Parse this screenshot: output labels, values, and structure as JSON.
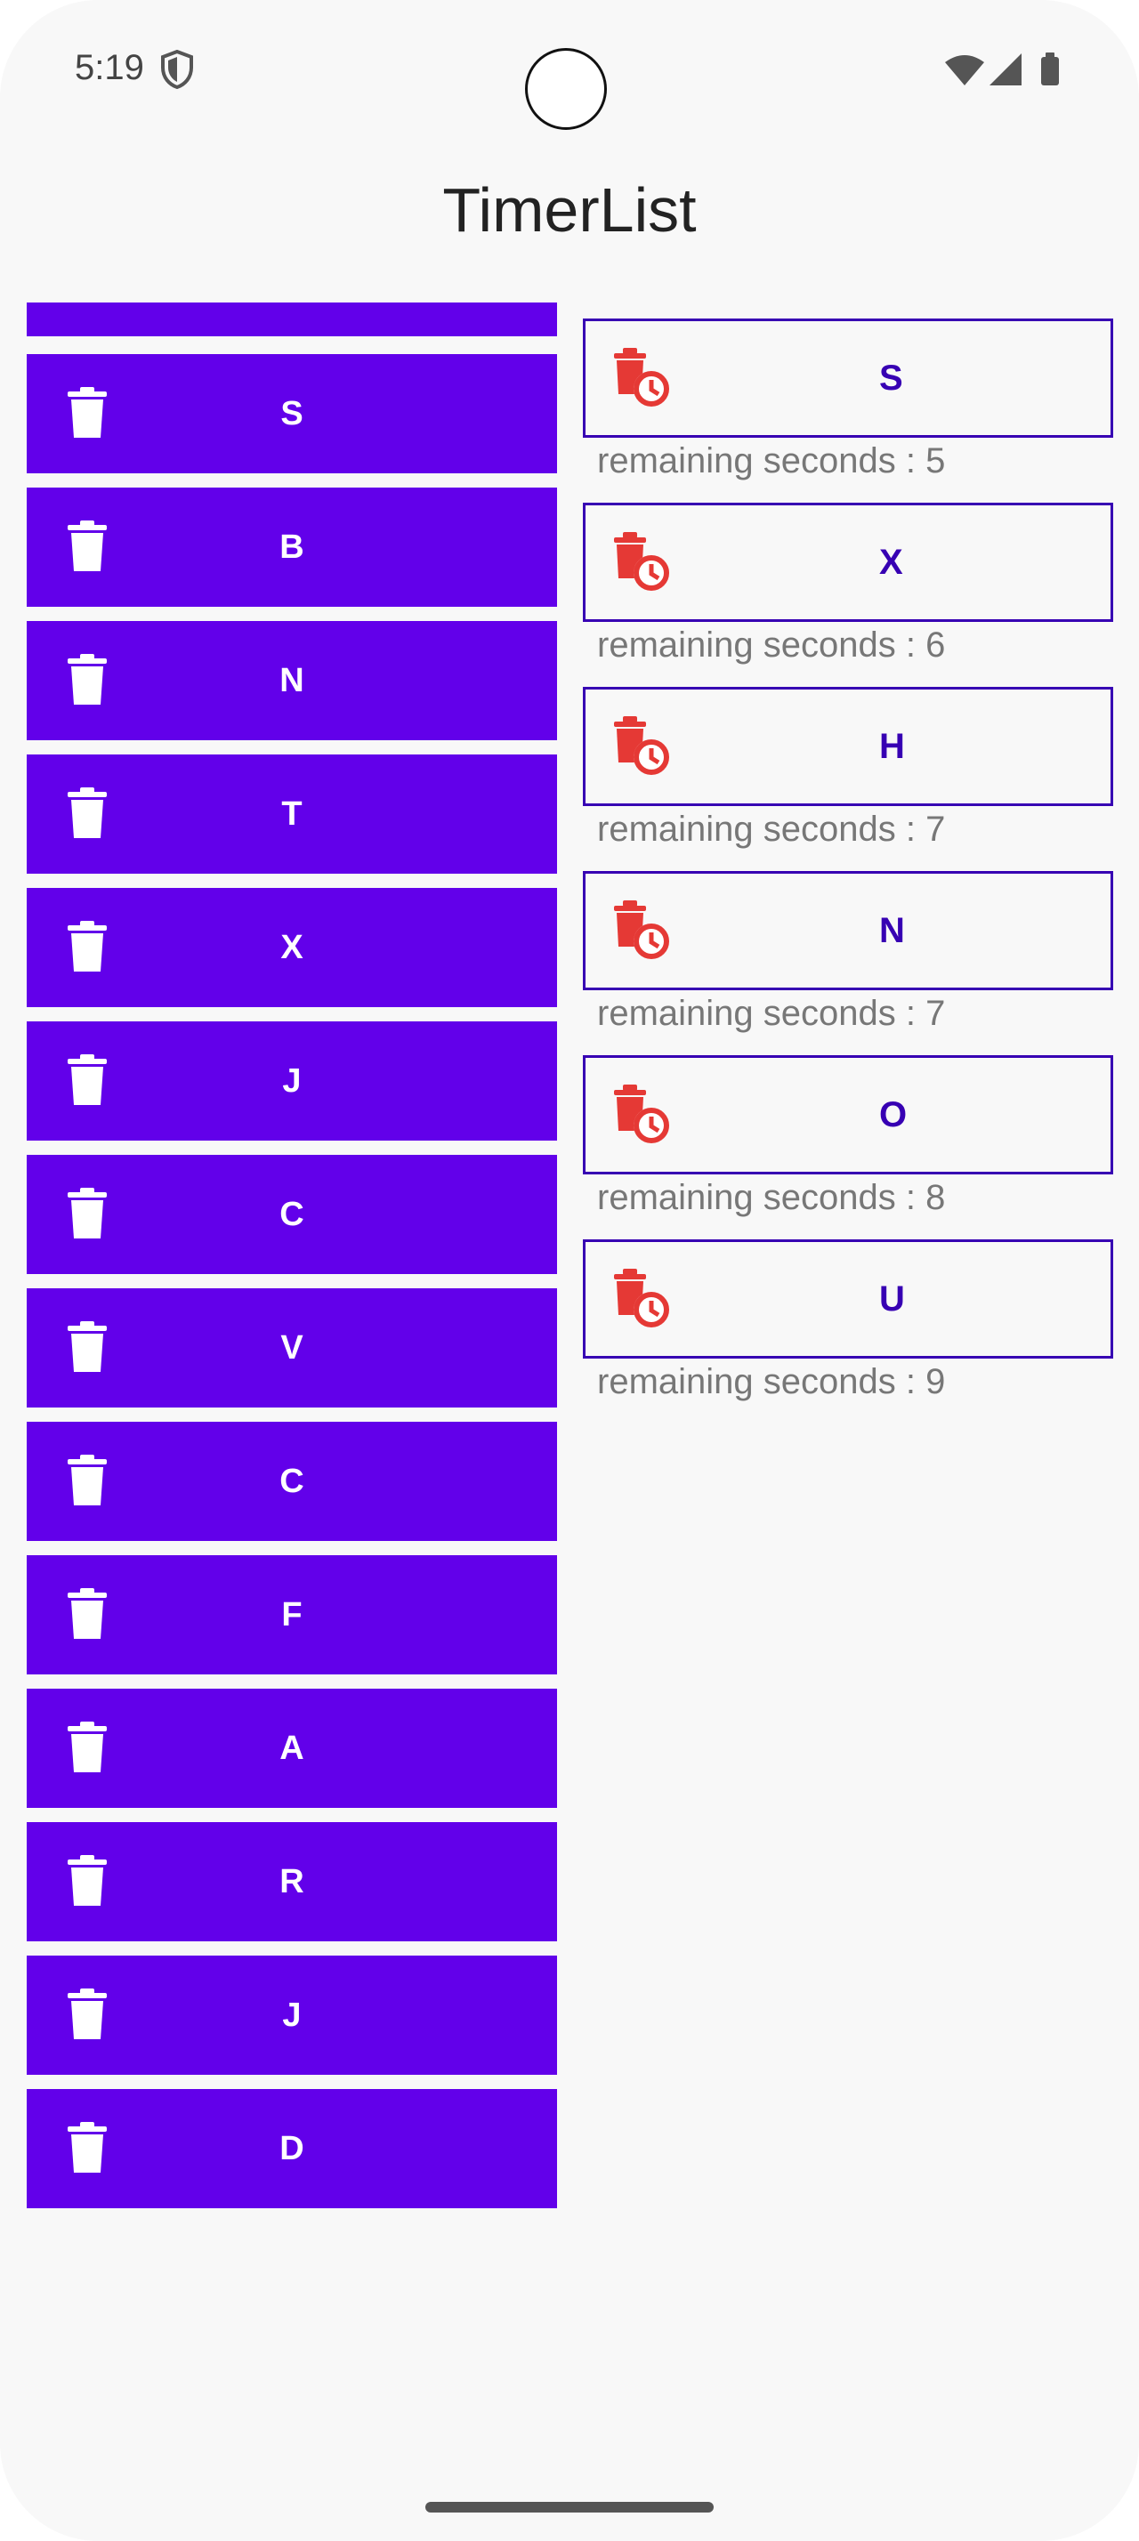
{
  "status_bar": {
    "time": "5:19",
    "icons": [
      "shield-icon",
      "wifi-icon",
      "signal-icon",
      "battery-icon"
    ]
  },
  "app": {
    "title": "TimerList"
  },
  "left_list": {
    "icon": "trash-icon",
    "bg_color": "#6200ea",
    "items": [
      "S",
      "B",
      "N",
      "T",
      "X",
      "J",
      "C",
      "V",
      "C",
      "F",
      "A",
      "R",
      "J",
      "D"
    ]
  },
  "right_list": {
    "icon": "trash-clock-icon",
    "accent_color": "#3700b3",
    "icon_color": "#e53935",
    "items": [
      {
        "label": "S",
        "remaining": "remaining seconds : 5"
      },
      {
        "label": "X",
        "remaining": "remaining seconds : 6"
      },
      {
        "label": "H",
        "remaining": "remaining seconds : 7"
      },
      {
        "label": "N",
        "remaining": "remaining seconds : 7"
      },
      {
        "label": "O",
        "remaining": "remaining seconds : 8"
      },
      {
        "label": "U",
        "remaining": "remaining seconds : 9"
      }
    ]
  }
}
